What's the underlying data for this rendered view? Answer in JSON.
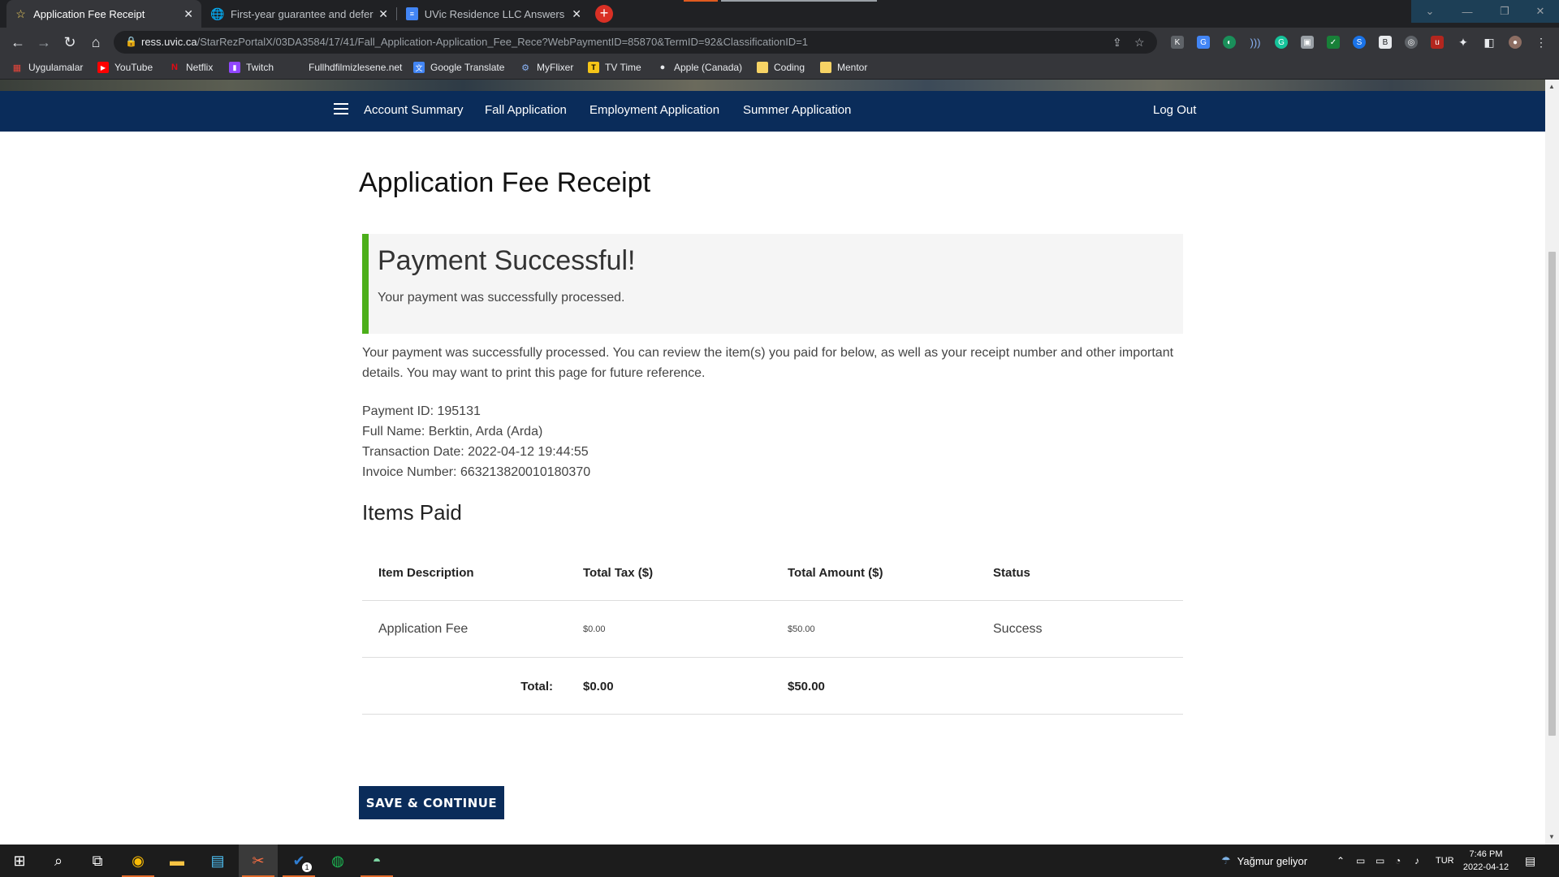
{
  "browser": {
    "tabs": [
      {
        "title": "Application Fee Receipt",
        "active": true
      },
      {
        "title": "First-year guarantee and deferral",
        "active": false
      },
      {
        "title": "UVic Residence LLC Answers - Go",
        "active": false
      }
    ],
    "url_host": "ress.uvic.ca",
    "url_path": "/StarRezPortalX/03DA3584/17/41/Fall_Application-Application_Fee_Rece?WebPaymentID=85870&TermID=92&ClassificationID=1",
    "bookmarks": [
      "Uygulamalar",
      "YouTube",
      "Netflix",
      "Twitch",
      "Fullhdfilmizlesene.net",
      "Google Translate",
      "MyFlixer",
      "TV Time",
      "Apple (Canada)",
      "Coding",
      "Mentor"
    ]
  },
  "nav": {
    "items": [
      "Account Summary",
      "Fall Application",
      "Employment Application",
      "Summer Application"
    ],
    "logout": "Log Out"
  },
  "page": {
    "title": "Application Fee Receipt",
    "alert": {
      "title": "Payment Successful!",
      "text": "Your payment was successfully processed."
    },
    "intro": "Your payment was successfully processed. You can review the item(s) you paid for below, as well as your receipt number and other important details. You may want to print this page for future reference.",
    "details": {
      "payment_id": "Payment ID: 195131",
      "full_name": "Full Name: Berktin, Arda (Arda)",
      "transaction_date": "Transaction Date: 2022-04-12 19:44:55",
      "invoice_number": "Invoice Number: 663213820010180370"
    },
    "items_heading": "Items Paid",
    "table": {
      "headers": [
        "Item Description",
        "Total Tax ($)",
        "Total Amount ($)",
        "Status"
      ],
      "rows": [
        {
          "description": "Application Fee",
          "tax": "$0.00",
          "amount": "$50.00",
          "status": "Success"
        }
      ],
      "total_label": "Total:",
      "total_tax": "$0.00",
      "total_amount": "$50.00"
    },
    "save_button": "SAVE & CONTINUE"
  },
  "taskbar": {
    "weather": "Yağmur geliyor",
    "language": "TUR",
    "time": "7:46 PM",
    "date": "2022-04-12",
    "badge": "1"
  },
  "colors": {
    "nav_bg": "#0a2c5a",
    "success_accent": "#4caf1a",
    "alert_bg": "#f5f5f5"
  }
}
